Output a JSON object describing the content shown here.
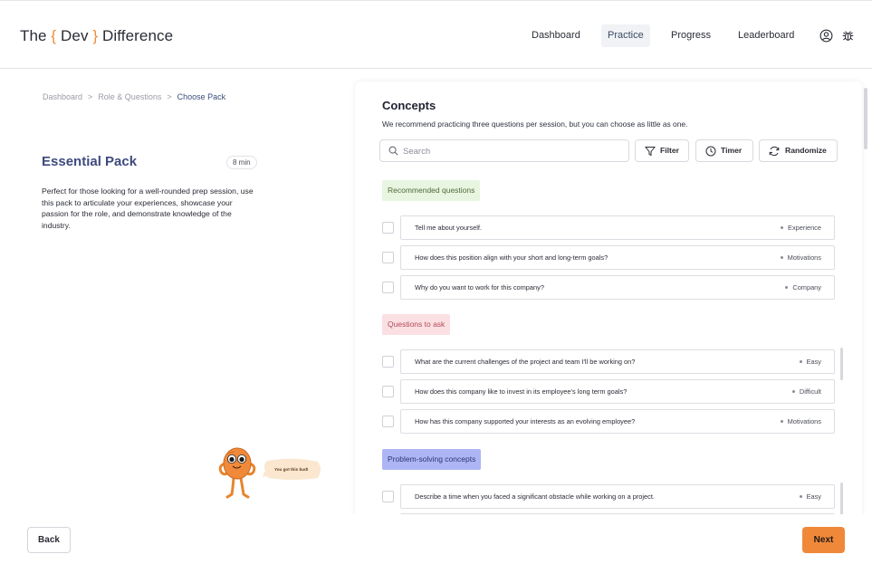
{
  "header": {
    "logo": {
      "the": "The",
      "open": "{",
      "dev": "Dev",
      "close": "}",
      "rest": "Difference"
    },
    "nav": [
      "Dashboard",
      "Practice",
      "Progress",
      "Leaderboard"
    ],
    "active_nav": "Practice",
    "icons": [
      "user-circle-icon",
      "bug-icon"
    ]
  },
  "breadcrumb": {
    "items": [
      "Dashboard",
      "Role & Questions",
      "Choose Pack"
    ],
    "separator": ">"
  },
  "pack": {
    "title": "Essential Pack",
    "duration": "8 min",
    "description": "Perfect for those looking for a well-rounded prep session, use this pack to articulate your experiences, showcase your passion for the role, and demonstrate knowledge of the industry.",
    "mascot_speech": "You got this bud!"
  },
  "concepts": {
    "title": "Concepts",
    "subtitle": "We recommend practicing three questions per session, but you can choose as little as one.",
    "search_placeholder": "Search",
    "buttons": {
      "filter": "Filter",
      "timer": "Timer",
      "randomize": "Randomize"
    },
    "sections": [
      {
        "label": "Recommended questions",
        "questions": [
          {
            "text": "Tell me about yourself.",
            "category": "Experience"
          },
          {
            "text": "How does this position align with your short and long-term goals?",
            "category": "Motivations"
          },
          {
            "text": "Why do you want to work for this company?",
            "category": "Company"
          }
        ]
      },
      {
        "label": "Questions to ask",
        "questions": [
          {
            "text": "What are the current challenges of the project and team I'll be working on?",
            "category": "Easy"
          },
          {
            "text": "How does this company like to invest in its employee's long term goals?",
            "category": "Difficult"
          },
          {
            "text": "How has this company supported your interests as an evolving employee?",
            "category": "Motivations"
          }
        ]
      },
      {
        "label": "Problem-solving concepts",
        "questions": [
          {
            "text": "Describe a time when you faced a significant obstacle while working on a project.",
            "category": "Easy"
          }
        ]
      }
    ]
  },
  "footer": {
    "back": "Back",
    "next": "Next"
  },
  "colors": {
    "accent": "#f0883a",
    "title": "#3f4a7e",
    "green_tag": "#e8f5e0",
    "pink_tag": "#fbe0e3",
    "blue_tag": "#aeb5f5"
  }
}
